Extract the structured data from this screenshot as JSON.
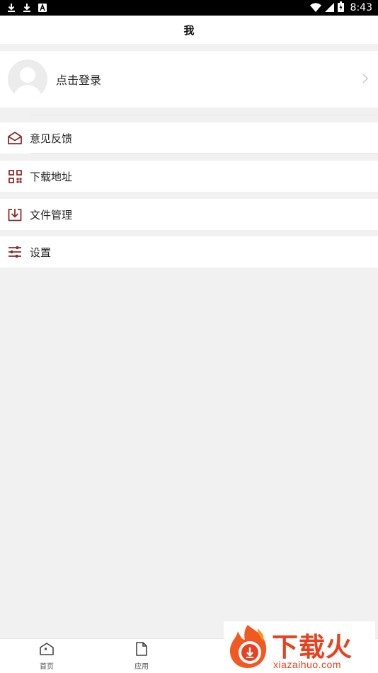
{
  "status_bar": {
    "time": "8:43",
    "left_icons": [
      "download-icon",
      "download-icon",
      "notification-a-icon"
    ],
    "right_icons": [
      "wifi-icon",
      "signal-icon",
      "battery-icon"
    ]
  },
  "header": {
    "title": "我"
  },
  "profile": {
    "login_text": "点击登录",
    "chevron_icon": "chevron-right-icon"
  },
  "menu": {
    "items": [
      {
        "label": "意见反馈",
        "icon": "mail-icon"
      },
      {
        "label": "下载地址",
        "icon": "qr-code-icon"
      },
      {
        "label": "文件管理",
        "icon": "download-tray-icon"
      },
      {
        "label": "设置",
        "icon": "sliders-icon"
      }
    ]
  },
  "bottom_nav": {
    "tabs": [
      {
        "label": "首页",
        "icon": "home-icon"
      },
      {
        "label": "应用",
        "icon": "file-icon"
      }
    ]
  },
  "watermark": {
    "brand": "下载火",
    "url": "xiazaihuo.com"
  },
  "colors": {
    "accent": "#8b2b2b",
    "background": "#f1f1f1",
    "brand_watermark": "#e8411f"
  }
}
